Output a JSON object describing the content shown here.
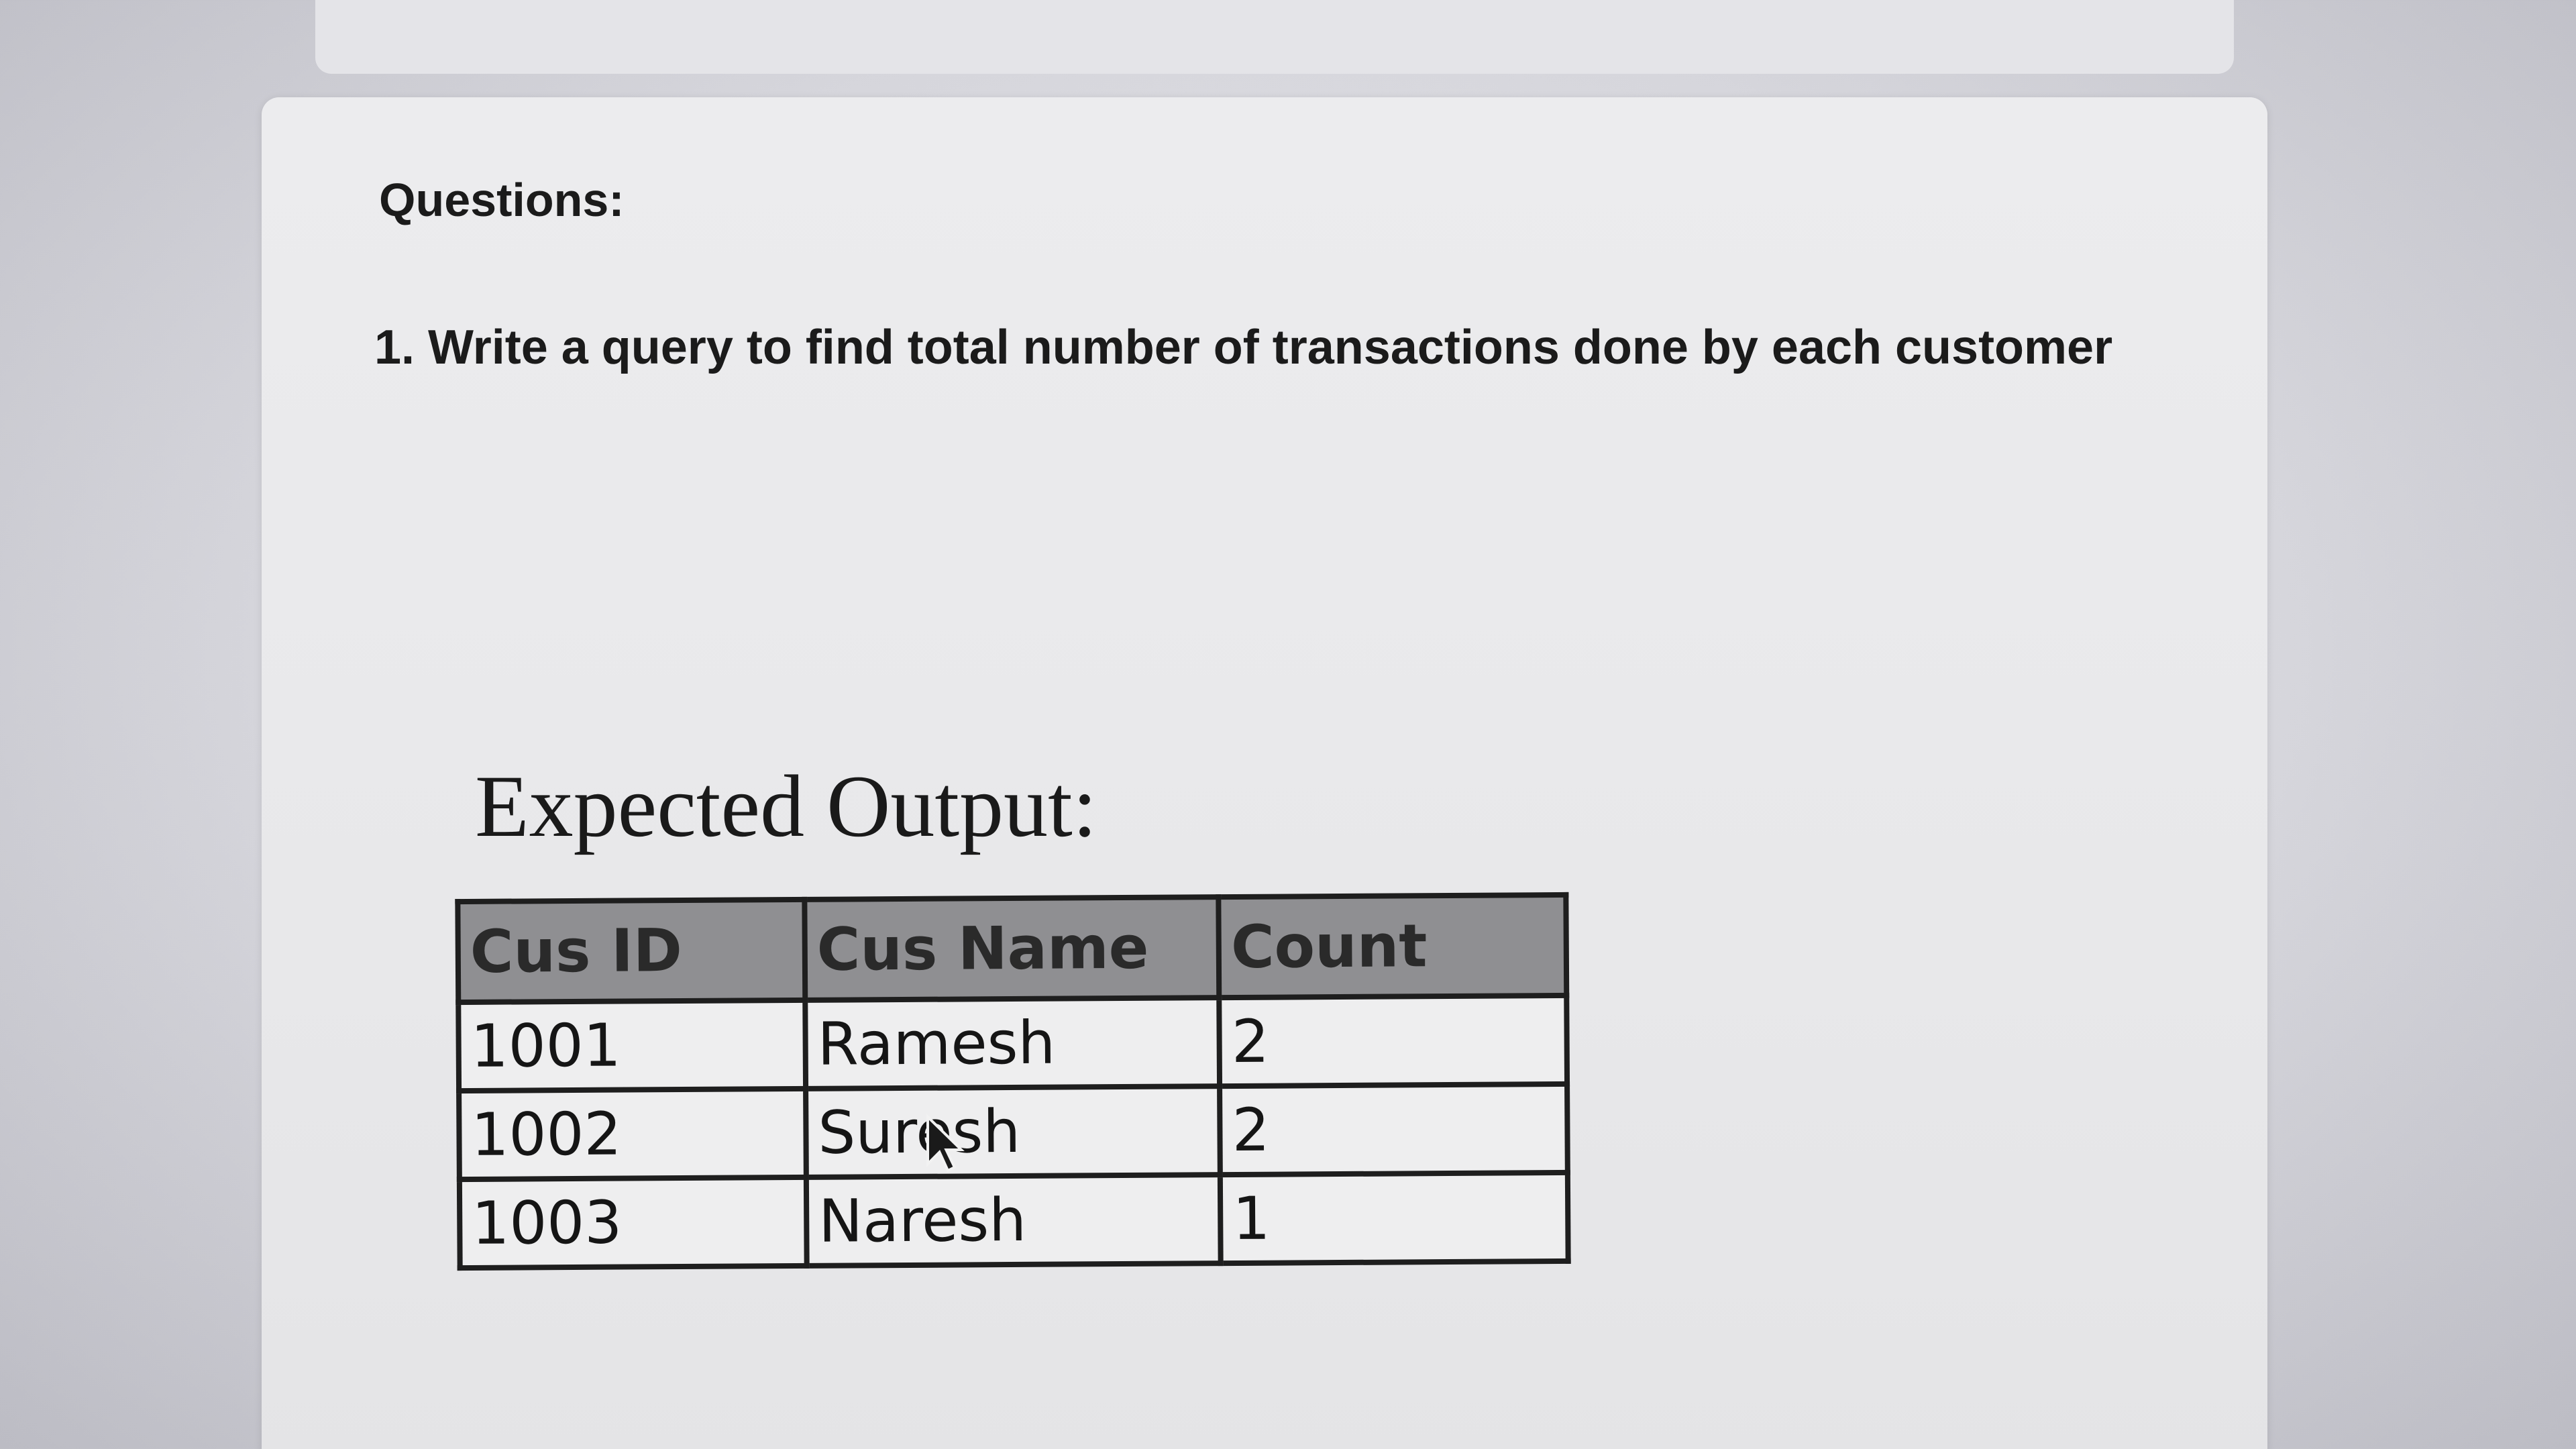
{
  "page": {
    "heading": "Questions:",
    "question": "1. Write a query to find total number of transactions done by each customer",
    "expected_title": "Expected Output:"
  },
  "table": {
    "headers": [
      "Cus ID",
      "Cus Name",
      "Count"
    ],
    "rows": [
      [
        "1001",
        "Ramesh",
        "2"
      ],
      [
        "1002",
        "Suresh",
        "2"
      ],
      [
        "1003",
        "Naresh",
        "1"
      ]
    ]
  },
  "colors": {
    "header_fill": "#8f8f92",
    "border": "#1e1e1e",
    "card": "#ececee"
  }
}
